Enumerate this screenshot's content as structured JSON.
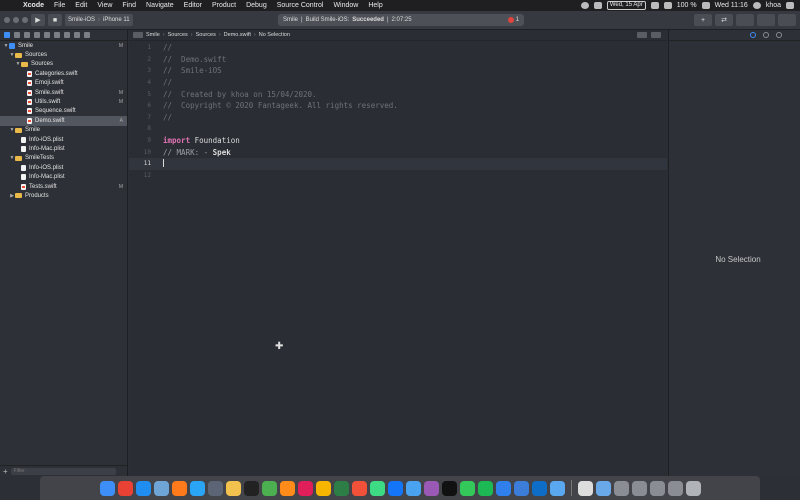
{
  "menubar": {
    "app": "Xcode",
    "items": [
      "File",
      "Edit",
      "View",
      "Find",
      "Navigate",
      "Editor",
      "Product",
      "Debug",
      "Source Control",
      "Window",
      "Help"
    ],
    "date": "Wed, 15 Apr",
    "battery": "100 %",
    "clock": "Wed 11:16",
    "user": "khoa"
  },
  "toolbar": {
    "scheme": "Smile-iOS",
    "device": "iPhone 11",
    "status_project": "Smile",
    "status_build": "Build Smile-iOS:",
    "status_result": "Succeeded",
    "status_time": "2:07:25",
    "error_count": "1"
  },
  "navigator": {
    "filter_placeholder": "Filter",
    "items": [
      {
        "label": "Smile",
        "type": "project",
        "depth": 0,
        "badge": "M",
        "disclosure": "▼"
      },
      {
        "label": "Sources",
        "type": "folder",
        "depth": 1,
        "badge": "",
        "disclosure": "▼"
      },
      {
        "label": "Sources",
        "type": "folder",
        "depth": 2,
        "badge": "",
        "disclosure": "▼"
      },
      {
        "label": "Categories.swift",
        "type": "swift",
        "depth": 3,
        "badge": ""
      },
      {
        "label": "Emoji.swift",
        "type": "swift",
        "depth": 3,
        "badge": ""
      },
      {
        "label": "Smile.swift",
        "type": "swift",
        "depth": 3,
        "badge": "M"
      },
      {
        "label": "Utils.swift",
        "type": "swift",
        "depth": 3,
        "badge": "M"
      },
      {
        "label": "Sequence.swift",
        "type": "swift",
        "depth": 3,
        "badge": ""
      },
      {
        "label": "Demo.swift",
        "type": "swift",
        "depth": 3,
        "badge": "A",
        "selected": true
      },
      {
        "label": "Smile",
        "type": "folder",
        "depth": 1,
        "badge": "",
        "disclosure": "▼"
      },
      {
        "label": "Info-iOS.plist",
        "type": "plist",
        "depth": 2,
        "badge": ""
      },
      {
        "label": "Info-Mac.plist",
        "type": "plist",
        "depth": 2,
        "badge": ""
      },
      {
        "label": "SmileTests",
        "type": "folder",
        "depth": 1,
        "badge": "",
        "disclosure": "▼"
      },
      {
        "label": "Info-iOS.plist",
        "type": "plist",
        "depth": 2,
        "badge": ""
      },
      {
        "label": "Info-Mac.plist",
        "type": "plist",
        "depth": 2,
        "badge": ""
      },
      {
        "label": "Tests.swift",
        "type": "swift",
        "depth": 2,
        "badge": "M"
      },
      {
        "label": "Products",
        "type": "folder",
        "depth": 1,
        "badge": "",
        "disclosure": "▶"
      }
    ]
  },
  "editor": {
    "breadcrumb": [
      "Smile",
      "Sources",
      "Sources",
      "Demo.swift",
      "No Selection"
    ],
    "current_line": "11",
    "lines": [
      {
        "n": "1",
        "text": "//",
        "kind": "comment"
      },
      {
        "n": "2",
        "text": "//  Demo.swift",
        "kind": "comment"
      },
      {
        "n": "3",
        "text": "//  Smile-iOS",
        "kind": "comment"
      },
      {
        "n": "4",
        "text": "//",
        "kind": "comment"
      },
      {
        "n": "5",
        "text": "//  Created by khoa on 15/04/2020.",
        "kind": "comment"
      },
      {
        "n": "6",
        "text": "//  Copyright © 2020 Fantageek. All rights reserved.",
        "kind": "comment"
      },
      {
        "n": "7",
        "text": "//",
        "kind": "comment"
      },
      {
        "n": "8",
        "text": "",
        "kind": "blank"
      },
      {
        "n": "9",
        "text": "import Foundation",
        "kind": "import"
      },
      {
        "n": "10",
        "text": "// MARK: - Spek",
        "kind": "mark"
      },
      {
        "n": "11",
        "text": "",
        "kind": "current"
      },
      {
        "n": "12",
        "text": "",
        "kind": "blank"
      }
    ]
  },
  "inspector": {
    "empty_label": "No Selection"
  },
  "dock": {
    "icons": [
      {
        "name": "finder-icon",
        "color": "#3e8ef7"
      },
      {
        "name": "chrome-icon",
        "color": "#e94235"
      },
      {
        "name": "xcode-icon",
        "color": "#1f8ef0"
      },
      {
        "name": "preview-icon",
        "color": "#6fa4d6"
      },
      {
        "name": "firefox-icon",
        "color": "#ff7a1a"
      },
      {
        "name": "safari-icon",
        "color": "#2aa4f4"
      },
      {
        "name": "simulator-icon",
        "color": "#5b6575"
      },
      {
        "name": "photos-icon",
        "color": "#f2c14e"
      },
      {
        "name": "terminal-icon",
        "color": "#222222"
      },
      {
        "name": "activity-icon",
        "color": "#4caf50"
      },
      {
        "name": "sublime-icon",
        "color": "#ff8c1a"
      },
      {
        "name": "slack-icon",
        "color": "#e01e5a"
      },
      {
        "name": "sketch-icon",
        "color": "#f7b500"
      },
      {
        "name": "sourcetree-icon",
        "color": "#2d7d46"
      },
      {
        "name": "swift-icon",
        "color": "#f05138"
      },
      {
        "name": "android-studio-icon",
        "color": "#3ddc84"
      },
      {
        "name": "xcode-icon",
        "color": "#1575f9"
      },
      {
        "name": "folder-icon",
        "color": "#4aa3f0"
      },
      {
        "name": "podcasts-icon",
        "color": "#9b59b6"
      },
      {
        "name": "tv-icon",
        "color": "#111111"
      },
      {
        "name": "messages-icon",
        "color": "#34c759"
      },
      {
        "name": "spotify-icon",
        "color": "#1db954"
      },
      {
        "name": "mail-icon",
        "color": "#2f80ed"
      },
      {
        "name": "instruments-icon",
        "color": "#3b7dd8"
      },
      {
        "name": "vscode-icon",
        "color": "#0e6ec7"
      },
      {
        "name": "folder-icon",
        "color": "#5aa9f0"
      },
      {
        "name": "keyboard-icon",
        "color": "#dddddd"
      },
      {
        "name": "screen-icon",
        "color": "#6aa9e9"
      },
      {
        "name": "window-icon",
        "color": "#8a8d94"
      },
      {
        "name": "window-icon",
        "color": "#8a8d94"
      },
      {
        "name": "window-icon",
        "color": "#8a8d94"
      },
      {
        "name": "window-icon",
        "color": "#8a8d94"
      },
      {
        "name": "trash-icon",
        "color": "#b0b3b8"
      }
    ]
  }
}
